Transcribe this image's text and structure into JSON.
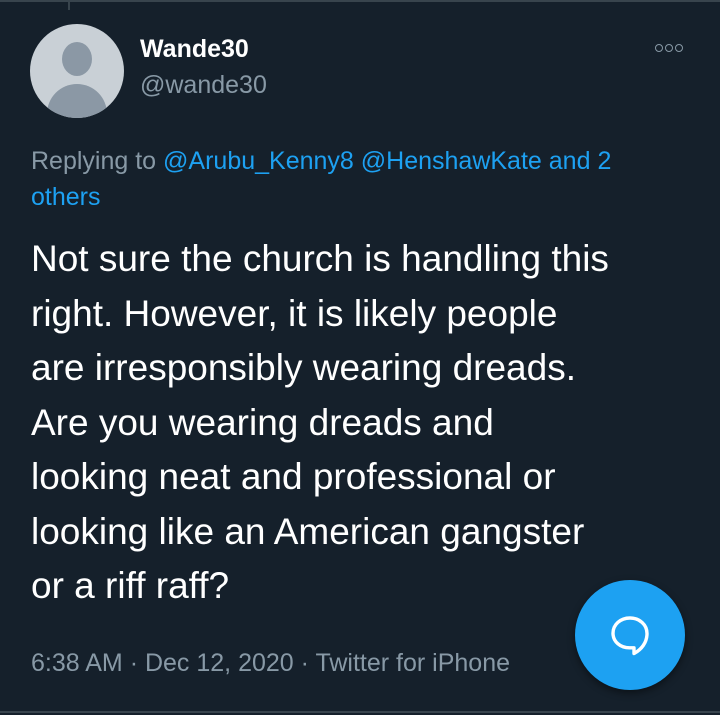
{
  "user": {
    "display_name": "Wande30",
    "handle": "@wande30"
  },
  "reply": {
    "prefix": "Replying to",
    "mentions": [
      "@Arubu_Kenny8",
      "@HenshawKate"
    ],
    "joiner": "and",
    "others": "2 others"
  },
  "tweet": {
    "lines": [
      "Not sure the church is handling this",
      "right. However, it is likely people",
      "are irresponsibly wearing dreads.",
      "Are you wearing dreads and",
      "looking neat and professional or",
      "looking like an American gangster",
      "or a riff raff?"
    ]
  },
  "meta": {
    "time": "6:38 AM",
    "separator": "·",
    "date": "Dec 12, 2020",
    "source": "Twitter for iPhone"
  },
  "icons": {
    "more": "more-options-icon",
    "reply": "reply-bubble-icon"
  },
  "colors": {
    "background": "#15202b",
    "text_primary": "#ffffff",
    "text_secondary": "#8899a6",
    "accent": "#1da1f2"
  }
}
